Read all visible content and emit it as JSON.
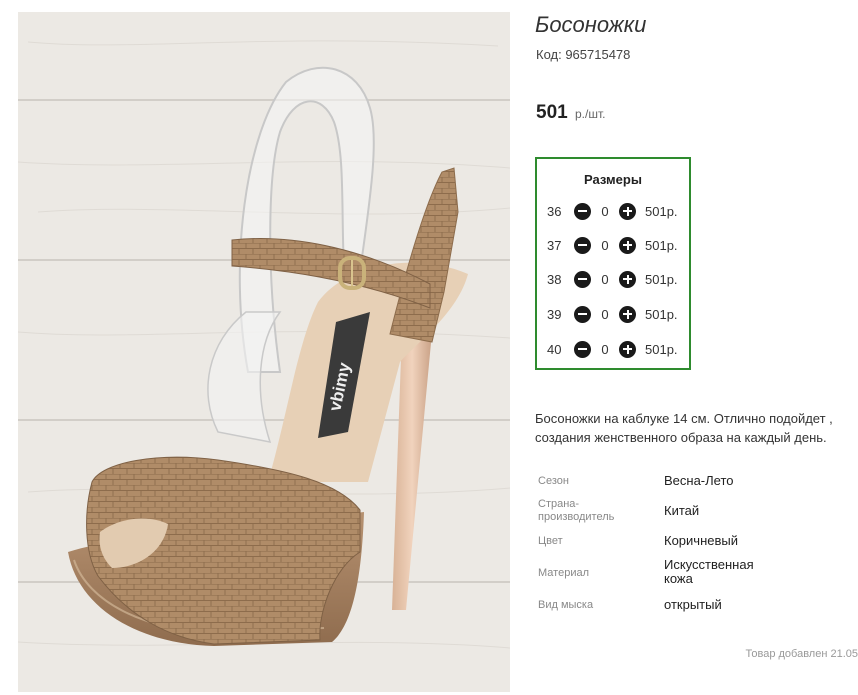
{
  "product": {
    "title": "Босоножки",
    "code": "Код: 965715478",
    "price": "501",
    "price_unit": "р./шт.",
    "image_brand": "vbimy"
  },
  "sizes": {
    "title": "Размеры",
    "rows": [
      {
        "size": "36",
        "qty": "0",
        "price": "501р."
      },
      {
        "size": "37",
        "qty": "0",
        "price": "501р."
      },
      {
        "size": "38",
        "qty": "0",
        "price": "501р."
      },
      {
        "size": "39",
        "qty": "0",
        "price": "501р."
      },
      {
        "size": "40",
        "qty": "0",
        "price": "501р."
      }
    ]
  },
  "description": {
    "line1": "Босоножки на каблуке 14 см. Отлично подойдет ,",
    "line2": "создания женственного образа на каждый день."
  },
  "properties": [
    {
      "label": "Сезон",
      "value": "Весна-Лето"
    },
    {
      "label": "Страна-\nпроизводитель",
      "value": "Китай"
    },
    {
      "label": "Цвет",
      "value": "Коричневый"
    },
    {
      "label": "Материал",
      "value": "Искусственная\nкожа"
    },
    {
      "label": "Вид мыска",
      "value": "открытый"
    }
  ],
  "footer": {
    "added": "Товар добавлен 21.05"
  },
  "colors": {
    "accent_border": "#2e8b2e",
    "shoe": "#b08c68",
    "floor": "#ece9e4"
  }
}
